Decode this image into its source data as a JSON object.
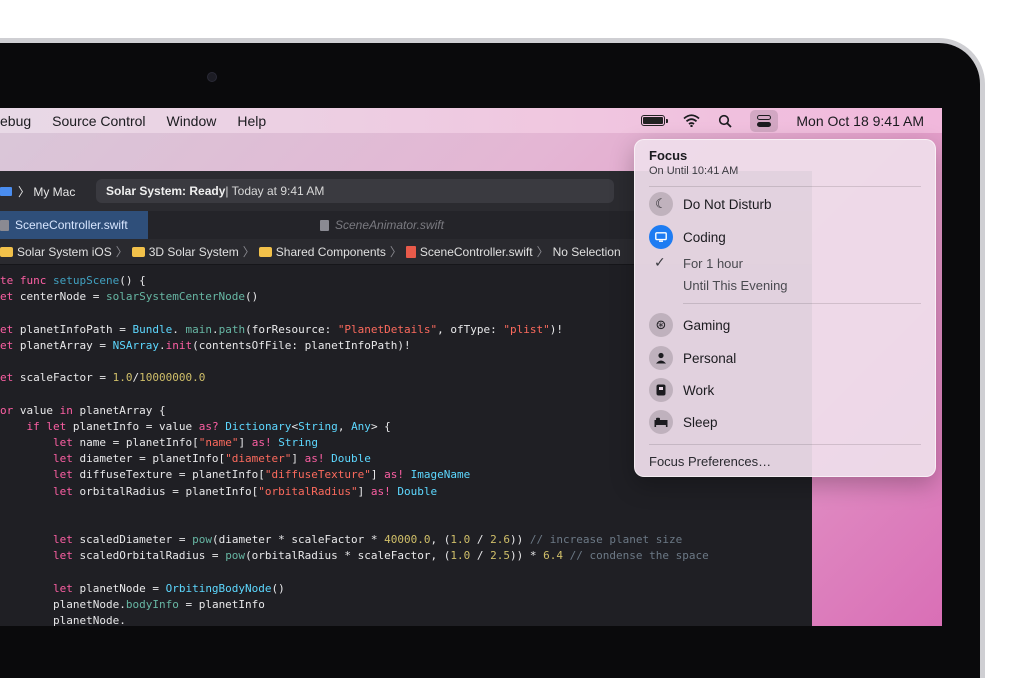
{
  "menubar": {
    "items": [
      "ebug",
      "Source Control",
      "Window",
      "Help"
    ],
    "datetime": "Mon Oct 18  9:41 AM"
  },
  "xcode": {
    "scheme_label": "〉 My Mac",
    "activity_bold": "Solar System:",
    "activity_status": "Ready",
    "activity_rest": " | Today at 9:41 AM",
    "tabs": [
      {
        "label": "SceneController.swift",
        "active": true
      },
      {
        "label": "SceneAnimator.swift",
        "active": false
      }
    ],
    "breadcrumbs": {
      "c1": "Solar System iOS",
      "c2": "3D Solar System",
      "c3": "Shared Components",
      "c4": "SceneController.swift",
      "c5": "No Selection",
      "sep": "〉"
    }
  },
  "focus": {
    "title": "Focus",
    "subtitle": "On Until 10:41 AM",
    "items": [
      {
        "label": "Do Not Disturb",
        "icon": "moon-icon"
      },
      {
        "label": "Coding",
        "icon": "display-icon"
      },
      {
        "label": "Gaming",
        "icon": "gamepad-icon"
      },
      {
        "label": "Personal",
        "icon": "person-icon"
      },
      {
        "label": "Work",
        "icon": "badge-icon"
      },
      {
        "label": "Sleep",
        "icon": "bed-icon"
      }
    ],
    "sub_options": [
      "For 1 hour",
      "Until This Evening"
    ],
    "check_glyph": "✓",
    "preferences": "Focus Preferences…"
  },
  "colors": {
    "accent": "#1e7cf2",
    "editor_bg": "#1f1f24",
    "keyword": "#fc5fa3",
    "string": "#fc6a5d",
    "number": "#d0bf69",
    "comment": "#6c7986"
  }
}
